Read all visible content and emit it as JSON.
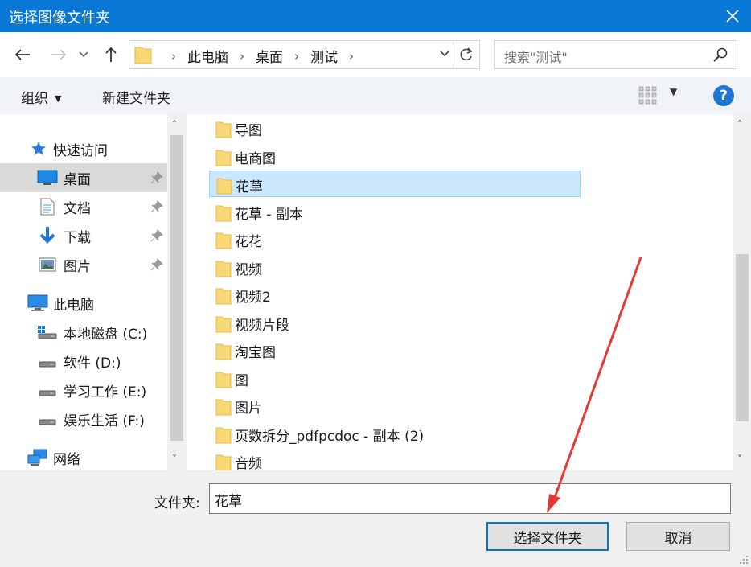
{
  "window": {
    "title": "选择图像文件夹",
    "close_icon": "close-icon"
  },
  "navbar": {
    "icons": [
      "back-arrow-icon",
      "forward-arrow-icon",
      "recent-dropdown-icon",
      "up-arrow-icon"
    ],
    "breadcrumbs": [
      "此电脑",
      "桌面",
      "测试"
    ],
    "search_placeholder": "搜索\"测试\""
  },
  "cmdbar": {
    "organize": "组织",
    "new_folder": "新建文件夹",
    "help": "?"
  },
  "sidebar": {
    "quick_access": "快速访问",
    "pinned": [
      "桌面",
      "文档",
      "下载",
      "图片"
    ],
    "this_pc": "此电脑",
    "drives": [
      "本地磁盘 (C:)",
      "软件 (D:)",
      "学习工作 (E:)",
      "娱乐生活 (F:)"
    ],
    "network": "网络"
  },
  "files": [
    "导图",
    "电商图",
    "花草",
    "花草 - 副本",
    "花花",
    "视频",
    "视频2",
    "视频片段",
    "淘宝图",
    "图",
    "图片",
    "页数拆分_pdfpcdoc - 副本 (2)",
    "音频"
  ],
  "selected_file": "花草",
  "footer": {
    "folder_label": "文件夹:",
    "folder_value": "花草",
    "select_button": "选择文件夹",
    "cancel_button": "取消"
  },
  "colors": {
    "titlebar": "#0a78d7",
    "selection": "#cce8ff",
    "folder": "#f8d775",
    "annotation_arrow": "#e53935"
  }
}
